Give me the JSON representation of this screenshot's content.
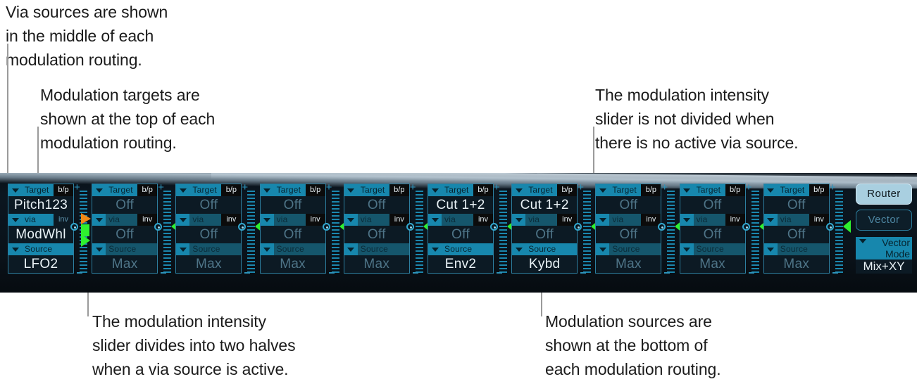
{
  "annotations": {
    "via": "Via sources are shown\nin the middle of each\nmodulation routing.",
    "target": "Modulation targets are\nshown at the top of each\nmodulation routing.",
    "not_divided": "The modulation intensity\nslider is not divided when\nthere is no active via source.",
    "divided": "The modulation intensity\nslider divides into two halves\nwhen a via source is active.",
    "source": "Modulation sources are\nshown at the bottom of\neach modulation routing."
  },
  "panel": {
    "row_labels": {
      "target": "Target",
      "via": "via",
      "source": "Source"
    },
    "badges": {
      "bypass": "b/p",
      "invert": "inv"
    },
    "slots": [
      {
        "index": 1,
        "target": "Pitch123",
        "via": "ModWhl",
        "source": "LFO2",
        "active": true,
        "via_active": true,
        "slider_divided": true,
        "slider_colors": {
          "upper": "#f08a17",
          "lower": "#2ff12f"
        }
      },
      {
        "index": 2,
        "target": "Off",
        "via": "Off",
        "source": "Max",
        "active": false,
        "via_active": false,
        "slider_divided": false,
        "slider_colors": {
          "pointer": "#2ff12f"
        }
      },
      {
        "index": 3,
        "target": "Off",
        "via": "Off",
        "source": "Max",
        "active": false,
        "via_active": false,
        "slider_divided": false,
        "slider_colors": {
          "pointer": "#2ff12f"
        }
      },
      {
        "index": 4,
        "target": "Off",
        "via": "Off",
        "source": "Max",
        "active": false,
        "via_active": false,
        "slider_divided": false,
        "slider_colors": {
          "pointer": "#2ff12f"
        }
      },
      {
        "index": 5,
        "target": "Off",
        "via": "Off",
        "source": "Max",
        "active": false,
        "via_active": false,
        "slider_divided": false,
        "slider_colors": {
          "pointer": "#2ff12f"
        }
      },
      {
        "index": 6,
        "target": "Cut 1+2",
        "via": "Off",
        "source": "Env2",
        "active": true,
        "via_active": false,
        "slider_divided": false,
        "slider_colors": {
          "pointer": "#2ff12f"
        }
      },
      {
        "index": 7,
        "target": "Cut 1+2",
        "via": "Off",
        "source": "Kybd",
        "active": true,
        "via_active": false,
        "slider_divided": false,
        "slider_colors": {
          "pointer": "#2ff12f"
        }
      },
      {
        "index": 8,
        "target": "Off",
        "via": "Off",
        "source": "Max",
        "active": false,
        "via_active": false,
        "slider_divided": false,
        "slider_colors": {
          "pointer": "#2ff12f"
        }
      },
      {
        "index": 9,
        "target": "Off",
        "via": "Off",
        "source": "Max",
        "active": false,
        "via_active": false,
        "slider_divided": false,
        "slider_colors": {
          "pointer": "#2ff12f"
        }
      },
      {
        "index": 10,
        "target": "Off",
        "via": "Off",
        "source": "Max",
        "active": false,
        "via_active": false,
        "slider_divided": false,
        "slider_colors": {
          "pointer": "#2ff12f"
        }
      }
    ],
    "right_column": {
      "router_button": "Router",
      "vector_button": "Vector",
      "vector_mode_label_line1": "Vector",
      "vector_mode_label_line2": "Mode",
      "vector_mode_value": "Mix+XY"
    }
  },
  "colors": {
    "panel_bg": "#0a1219",
    "accent_cyan": "#1787ad",
    "border_cyan": "#2d7fa0",
    "text_light": "#e9f2f6",
    "text_off": "#4e7487",
    "green": "#2ff12f",
    "orange": "#f08a17",
    "router_active_bg": "#a9cfe0"
  }
}
